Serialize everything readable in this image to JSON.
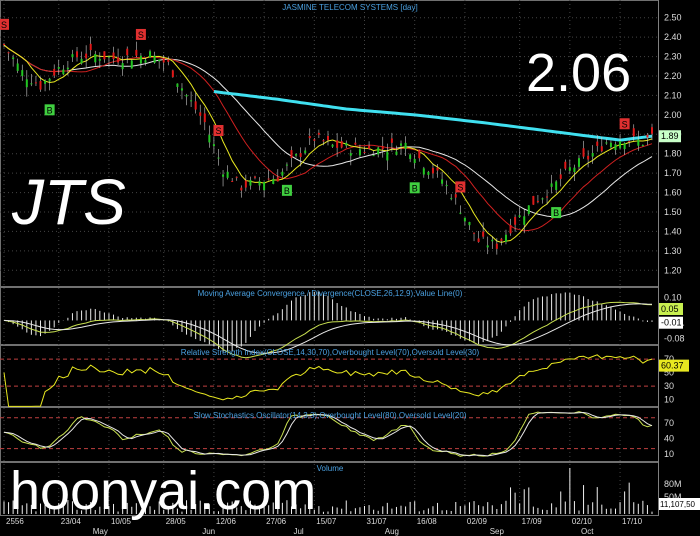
{
  "overlays": {
    "ticker": "JTS",
    "last_price": "2.06",
    "watermark": "hoonyai.com"
  },
  "panels": {
    "price_title": "JASMINE TELECOM SYSTEMS [day]",
    "macd_title": "Moving Average Convergence / Divergence(CLOSE,26,12,9),Value Line(0)",
    "rsi_title": "Relative Strength Index(CLOSE,14,30,70),Overbought Level(70),Oversold Level(30)",
    "stoch_title": "Slow Stochastics Oscillator(14,3,3),Overbought Level(80),Oversold Level(20)",
    "volume_title": "Volume"
  },
  "colors": {
    "grid": "#444444",
    "up": "#22c722",
    "down": "#e01818",
    "ma_fast": "#e8e820",
    "ma_mid": "#d02020",
    "ma_slow": "#e8e8e8",
    "ma_long": "#40e0f0",
    "panel_line": "#e8e820",
    "level_line": "#c04040",
    "buy": "#40d040",
    "sell": "#e03030"
  },
  "chart_data": [
    {
      "type": "candlestick",
      "title": "JASMINE TELECOM SYSTEMS [day]",
      "ylim": [
        1.15,
        2.55
      ],
      "yticks": [
        "2.50",
        "2.40",
        "2.30",
        "2.20",
        "2.10",
        "2.00",
        "1.90",
        "1.80",
        "1.70",
        "1.60",
        "1.50",
        "1.40",
        "1.30",
        "1.20"
      ],
      "last_value": "1.89",
      "x_labels": [
        "2556",
        "23/04",
        "10/05",
        "28/05",
        "12/06",
        "27/06",
        "15/07",
        "31/07",
        "16/08",
        "02/09",
        "17/09",
        "02/10",
        "17/10"
      ],
      "month_labels": [
        "May",
        "Jun",
        "Jul",
        "Aug",
        "Sep",
        "Oct"
      ],
      "close_path": [
        [
          0,
          2.36
        ],
        [
          4,
          2.22
        ],
        [
          8,
          2.15
        ],
        [
          12,
          2.24
        ],
        [
          16,
          2.3
        ],
        [
          20,
          2.31
        ],
        [
          24,
          2.29
        ],
        [
          28,
          2.3
        ],
        [
          32,
          2.31
        ],
        [
          36,
          2.26
        ],
        [
          40,
          2.1
        ],
        [
          44,
          1.96
        ],
        [
          48,
          1.72
        ],
        [
          52,
          1.63
        ],
        [
          56,
          1.66
        ],
        [
          60,
          1.68
        ],
        [
          64,
          1.78
        ],
        [
          68,
          1.88
        ],
        [
          72,
          1.84
        ],
        [
          76,
          1.83
        ],
        [
          80,
          1.82
        ],
        [
          84,
          1.83
        ],
        [
          88,
          1.85
        ],
        [
          92,
          1.75
        ],
        [
          96,
          1.67
        ],
        [
          100,
          1.52
        ],
        [
          104,
          1.35
        ],
        [
          108,
          1.33
        ],
        [
          112,
          1.45
        ],
        [
          116,
          1.55
        ],
        [
          120,
          1.62
        ],
        [
          124,
          1.72
        ],
        [
          128,
          1.78
        ],
        [
          132,
          1.86
        ],
        [
          136,
          1.88
        ],
        [
          140,
          1.86
        ],
        [
          142,
          1.89
        ]
      ],
      "signals": [
        {
          "type": "S",
          "i": 0
        },
        {
          "type": "S",
          "i": 30
        },
        {
          "type": "B",
          "i": 10
        },
        {
          "type": "S",
          "i": 47
        },
        {
          "type": "B",
          "i": 62
        },
        {
          "type": "B",
          "i": 90
        },
        {
          "type": "S",
          "i": 100
        },
        {
          "type": "B",
          "i": 121
        },
        {
          "type": "S",
          "i": 136
        }
      ],
      "ma_long_start": 46,
      "ma_long_values": [
        [
          46,
          2.12
        ],
        [
          60,
          2.08
        ],
        [
          75,
          2.03
        ],
        [
          90,
          2.0
        ],
        [
          105,
          1.96
        ],
        [
          115,
          1.93
        ],
        [
          125,
          1.9
        ],
        [
          135,
          1.87
        ],
        [
          142,
          1.89
        ]
      ]
    },
    {
      "type": "line",
      "title": "Moving Average Convergence / Divergence(CLOSE,26,12,9),Value Line(0)",
      "ylim": [
        -0.09,
        0.12
      ],
      "yticks": [
        "0.10",
        "0.05",
        "-0.01",
        "-0.08"
      ],
      "labels_right": [
        "0.05",
        "-0.01"
      ]
    },
    {
      "type": "line",
      "title": "Relative Strength Index(CLOSE,14,30,70),Overbought Level(70),Oversold Level(30)",
      "ylim": [
        5,
        85
      ],
      "yticks": [
        "70",
        "50",
        "30",
        "10"
      ],
      "last_value": "60.37"
    },
    {
      "type": "line",
      "title": "Slow Stochastics Oscillator(14,3,3),Overbought Level(80),Oversold Level(20)",
      "ylim": [
        0,
        95
      ],
      "yticks": [
        "70",
        "40",
        "10"
      ]
    },
    {
      "type": "bar",
      "title": "Volume",
      "yticks": [
        "80M",
        "50M"
      ],
      "last_value": "11,107,50"
    }
  ]
}
